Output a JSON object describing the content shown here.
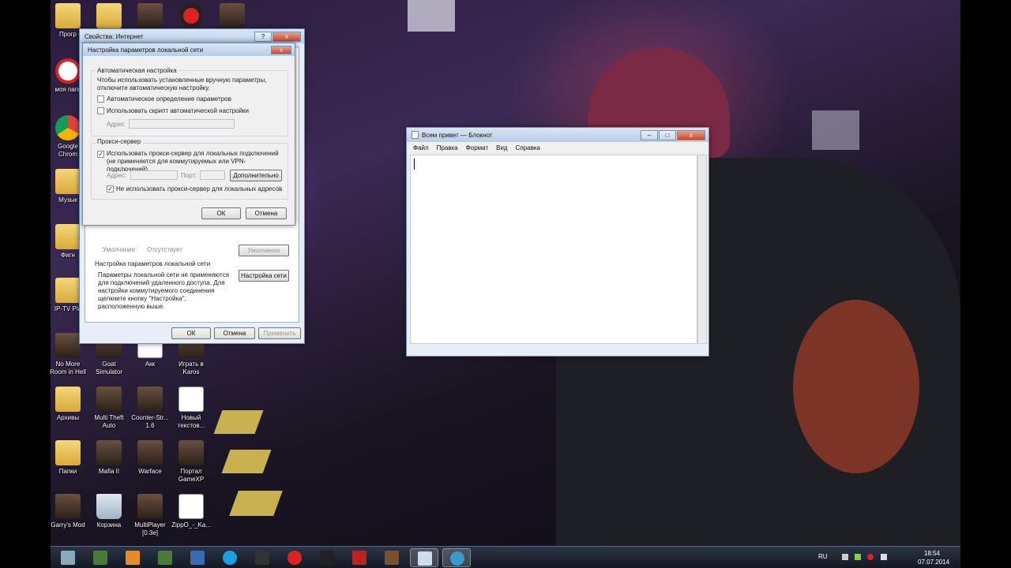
{
  "colors": {
    "accent": "#3b6ea5",
    "close": "#c9482d",
    "taskbar": "#1b2230"
  },
  "desktop_icons": [
    {
      "label": "Прогр",
      "icon": "folder-icon"
    },
    {
      "label": "",
      "icon": "folder-icon"
    },
    {
      "label": "",
      "icon": "game-icon"
    },
    {
      "label": "",
      "icon": "record-icon"
    },
    {
      "label": "",
      "icon": "game-icon"
    },
    {
      "label": "моя папк",
      "icon": "blocked-icon"
    },
    {
      "label": "Google Chrom",
      "icon": "chrome-icon"
    },
    {
      "label": "Музык",
      "icon": "folder-icon"
    },
    {
      "label": "Фигн",
      "icon": "folder-icon"
    },
    {
      "label": "IP-TV Pla",
      "icon": "folder-icon"
    },
    {
      "label": "No More Room in Hell",
      "icon": "game-icon"
    },
    {
      "label": "Goat Simulator",
      "icon": "game-icon"
    },
    {
      "label": "Акк",
      "icon": "document-icon"
    },
    {
      "label": "Играть в Karos",
      "icon": "game-icon"
    },
    {
      "label": "Архивы",
      "icon": "folder-icon"
    },
    {
      "label": "Multi Theft Auto",
      "icon": "game-icon"
    },
    {
      "label": "Counter-Str... 1.6",
      "icon": "game-icon"
    },
    {
      "label": "Новый текстов...",
      "icon": "document-icon"
    },
    {
      "label": "Папки",
      "icon": "folder-icon"
    },
    {
      "label": "Mafia II",
      "icon": "game-icon"
    },
    {
      "label": "Warface",
      "icon": "game-icon"
    },
    {
      "label": "Портал GameXP",
      "icon": "game-icon"
    },
    {
      "label": "Garry's Mod",
      "icon": "game-icon"
    },
    {
      "label": "Корзина",
      "icon": "recycle-bin-icon"
    },
    {
      "label": "MultiPlayer [0.3e]",
      "icon": "game-icon"
    },
    {
      "label": "ZippO_-_Ka...",
      "icon": "mp3-icon"
    }
  ],
  "internet_props": {
    "title": "Свойства: Интернет",
    "help": "?",
    "close": "x",
    "defaults_label": "Умолчание:",
    "defaults_value": "Отсутствует",
    "defaults_button": "Умолчание",
    "lan_group_title": "Настройка параметров локальной сети",
    "lan_desc": "Параметры локальной сети не применяются для подключений удаленного доступа. Для настройки коммутируемого соединения щелкните кнопку \"Настройка\", расположенную выше.",
    "lan_button": "Настройка сети",
    "ok": "ОК",
    "cancel": "Отмена",
    "apply": "Применить"
  },
  "lan_dialog": {
    "title": "Настройка параметров локальной сети",
    "close": "x",
    "auto_group": "Автоматическая настройка",
    "auto_desc": "Чтобы использовать установленные вручную параметры, отключите автоматическую настройку.",
    "auto_detect": "Автоматическое определение параметров",
    "use_script": "Использовать скрипт автоматической настройки",
    "address_label": "Адрес",
    "proxy_group": "Прокси-сервер",
    "use_proxy": "Использовать прокси-сервер для локальных подключений (не применяется для коммутируемых или VPN-подключений).",
    "proxy_address": "Адрес:",
    "proxy_port": "Порт:",
    "advanced": "Дополнительно",
    "bypass_local": "Не использовать прокси-сервер для локальных адресов",
    "ok": "ОК",
    "cancel": "Отмена",
    "checked_mark": "✓"
  },
  "notepad": {
    "title": "Всем привет — Блокнот",
    "min": "–",
    "max": "□",
    "close": "x",
    "menu": [
      "Файл",
      "Правка",
      "Формат",
      "Вид",
      "Справка"
    ]
  },
  "taskbar": {
    "items": [
      "start-icon",
      "minecraft-icon",
      "media-player-icon",
      "minecraft-icon",
      "launcher-icon",
      "skype-icon",
      "steam-icon",
      "opera-icon",
      "warface-icon",
      "mafia-icon",
      "game-icon",
      "notepad-icon",
      "network-icon"
    ],
    "lang": "RU",
    "time": "18:54",
    "date": "07.07.2014"
  }
}
